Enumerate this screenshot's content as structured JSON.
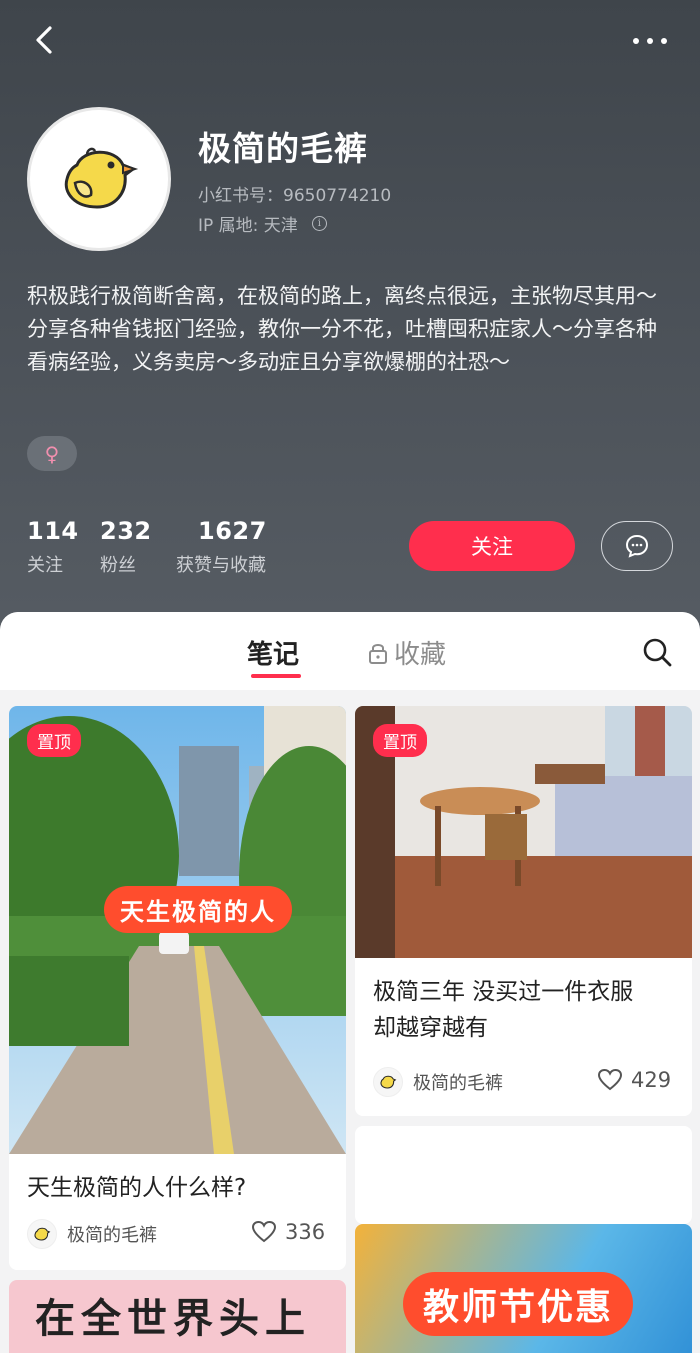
{
  "profile": {
    "nickname": "极简的毛裤",
    "red_id": "小红书号：9650774210",
    "ip_location": "IP 属地: 天津",
    "bio_line1": "积极践行极简断舍离，在极简的路上，离终点很远，主张物尽其用～",
    "bio_line2": "分享各种省钱抠门经验，教你一分不花，吐槽囤积症家人～分享各种看病经验，义务卖房～多动症且分享欲爆棚的社恐～",
    "gender_symbol": "♀"
  },
  "stats": [
    {
      "value": "114",
      "label": "关注"
    },
    {
      "value": "232",
      "label": "粉丝"
    },
    {
      "value": "1627",
      "label": "获赞与收藏"
    }
  ],
  "actions": {
    "follow_label": "关注"
  },
  "tabs": {
    "notes": "笔记",
    "favorites": "收藏"
  },
  "notes": [
    {
      "pin": "置顶",
      "image_text": "天生极简的人",
      "title": "天生极简的人什么样?",
      "author": "极简的毛裤",
      "likes": "336"
    },
    {
      "pin": "置顶",
      "title_line1": "极简三年 没买过一件衣服",
      "title_line2": "却越穿越有",
      "author": "极简的毛裤",
      "likes": "429"
    },
    {
      "image_text": "在全世界头上"
    },
    {
      "image_text": "教师节优惠"
    }
  ],
  "colors": {
    "accent": "#ff2e4d",
    "header_bg": "#4a5057"
  }
}
